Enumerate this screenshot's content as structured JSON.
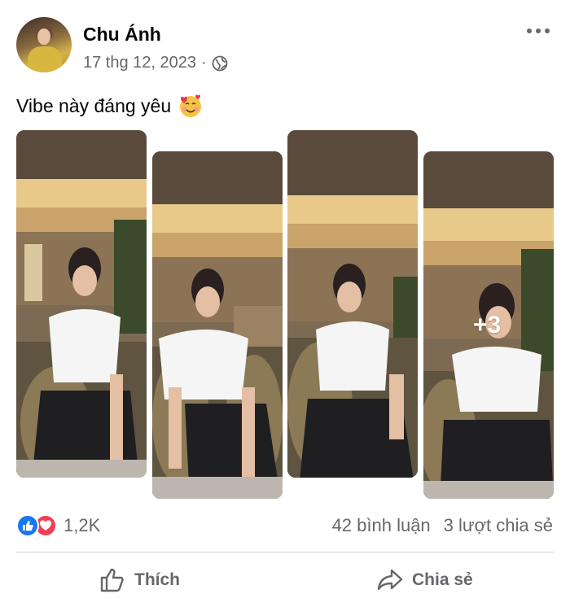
{
  "post": {
    "author": "Chu Ánh",
    "date": "17 thg 12, 2023",
    "separator": "·",
    "privacy_icon": "globe-icon",
    "caption": "Vibe này đáng yêu",
    "caption_emoji": "smiling-face-with-hearts",
    "more_photos_label": "+3",
    "photo_count_visible": 4
  },
  "reactions": {
    "icons": [
      "like-icon",
      "love-icon"
    ],
    "count": "1,2K",
    "comments": "42 bình luận",
    "shares": "3 lượt chia sẻ"
  },
  "actions": {
    "like_label": "Thích",
    "share_label": "Chia sẻ"
  },
  "colors": {
    "like_blue": "#1877f2",
    "love_red": "#f33e58",
    "secondary_text": "#65676b"
  }
}
